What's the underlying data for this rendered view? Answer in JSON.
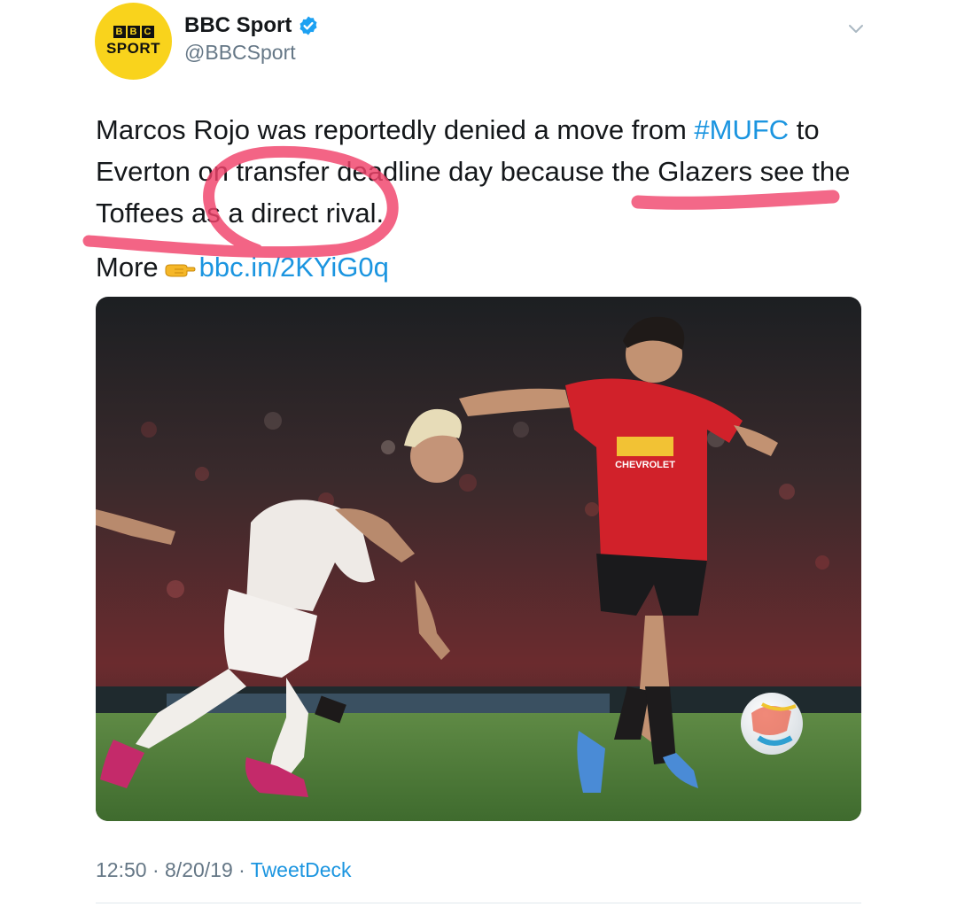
{
  "account": {
    "avatar_top": "BBC",
    "avatar_bottom": "SPORT",
    "display_name": "BBC Sport",
    "handle": "@BBCSport",
    "verified": true,
    "avatar_color": "#f9d31c"
  },
  "tweet": {
    "line1_pre": "Marcos Rojo was reportedly denied a move from ",
    "hashtag": "#MUFC",
    "line1_post": " to",
    "line2": "Everton on transfer deadline day because the Glazers see the",
    "line3": "Toffees as a direct rival.",
    "more_label": "More",
    "link": "bbc.in/2KYiG0q"
  },
  "icons": {
    "verified": "verified-badge-icon",
    "menu": "chevron-down-icon",
    "pointer": "pointing-hand-emoji-icon"
  },
  "media": {
    "description_players_shirt": "CHEVROLET"
  },
  "meta": {
    "time": "12:50",
    "sep1": " · ",
    "date": "8/20/19",
    "sep2": " · ",
    "source": "TweetDeck"
  },
  "colors": {
    "link": "#1b95e0",
    "annotation": "#f0426a",
    "muted": "#657786"
  }
}
